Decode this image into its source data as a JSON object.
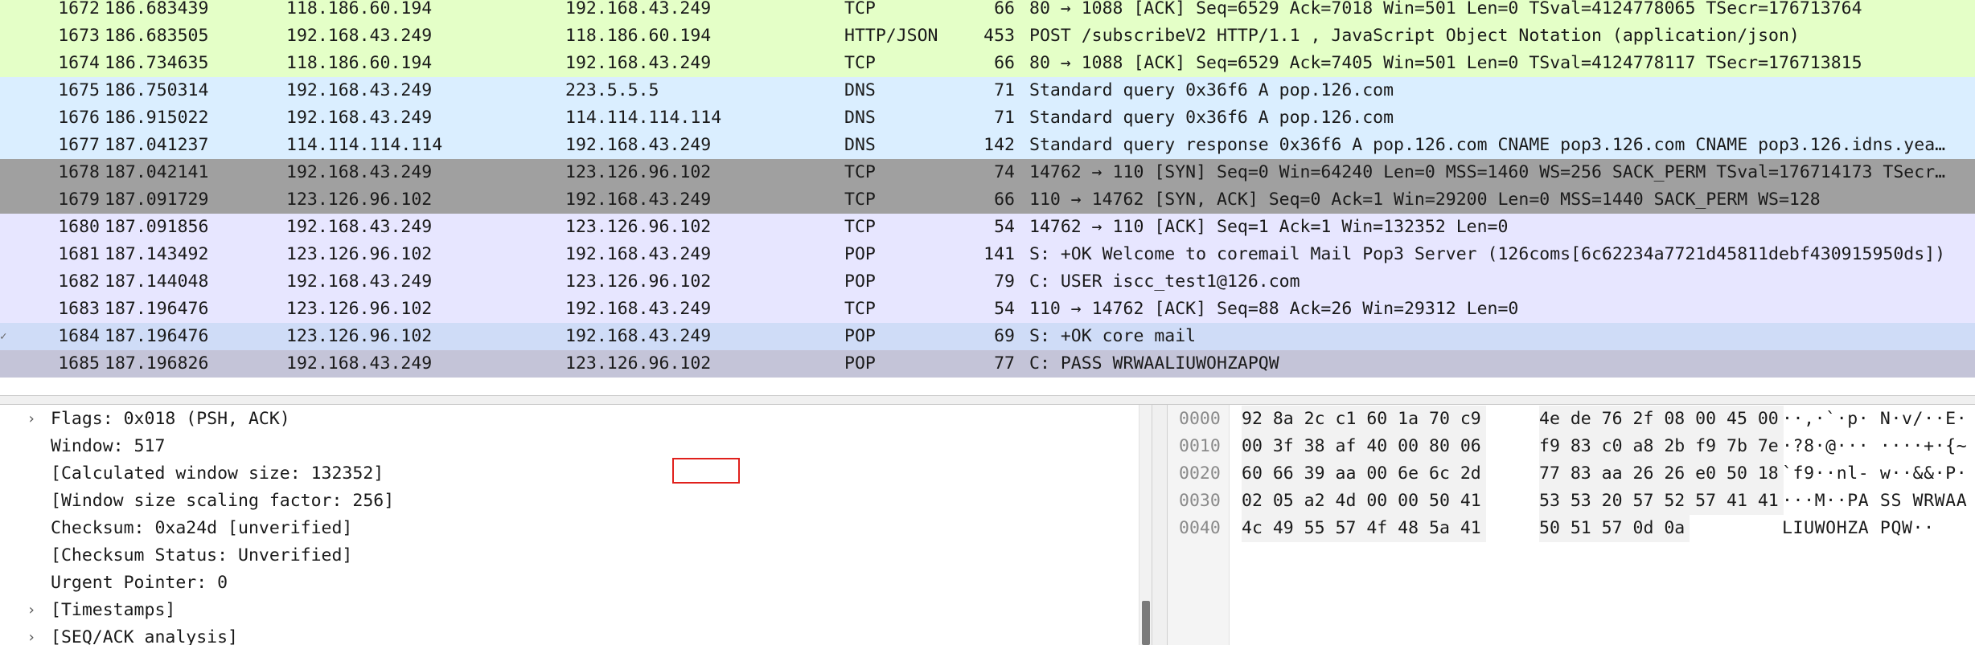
{
  "packets": [
    {
      "no": "1672",
      "time": "186.683439",
      "src": "118.186.60.194",
      "dst": "192.168.43.249",
      "proto": "TCP",
      "len": "66",
      "info": "80 → 1088 [ACK] Seq=6529 Ack=7018 Win=501 Len=0 TSval=4124778065 TSecr=176713764",
      "bg": "#e4ffc7"
    },
    {
      "no": "1673",
      "time": "186.683505",
      "src": "192.168.43.249",
      "dst": "118.186.60.194",
      "proto": "HTTP/JSON",
      "len": "453",
      "info": "POST /subscribeV2 HTTP/1.1 , JavaScript Object Notation (application/json)",
      "bg": "#e4ffc7"
    },
    {
      "no": "1674",
      "time": "186.734635",
      "src": "118.186.60.194",
      "dst": "192.168.43.249",
      "proto": "TCP",
      "len": "66",
      "info": "80 → 1088 [ACK] Seq=6529 Ack=7405 Win=501 Len=0 TSval=4124778117 TSecr=176713815",
      "bg": "#e4ffc7"
    },
    {
      "no": "1675",
      "time": "186.750314",
      "src": "192.168.43.249",
      "dst": "223.5.5.5",
      "proto": "DNS",
      "len": "71",
      "info": "Standard query 0x36f6 A pop.126.com",
      "bg": "#daeeff"
    },
    {
      "no": "1676",
      "time": "186.915022",
      "src": "192.168.43.249",
      "dst": "114.114.114.114",
      "proto": "DNS",
      "len": "71",
      "info": "Standard query 0x36f6 A pop.126.com",
      "bg": "#daeeff"
    },
    {
      "no": "1677",
      "time": "187.041237",
      "src": "114.114.114.114",
      "dst": "192.168.43.249",
      "proto": "DNS",
      "len": "142",
      "info": "Standard query response 0x36f6 A pop.126.com CNAME pop3.126.com CNAME pop3.126.idns.yea…",
      "bg": "#daeeff"
    },
    {
      "no": "1678",
      "time": "187.042141",
      "src": "192.168.43.249",
      "dst": "123.126.96.102",
      "proto": "TCP",
      "len": "74",
      "info": "14762 → 110 [SYN] Seq=0 Win=64240 Len=0 MSS=1460 WS=256 SACK_PERM TSval=176714173 TSecr…",
      "bg": "#a0a0a0"
    },
    {
      "no": "1679",
      "time": "187.091729",
      "src": "123.126.96.102",
      "dst": "192.168.43.249",
      "proto": "TCP",
      "len": "66",
      "info": "110 → 14762 [SYN, ACK] Seq=0 Ack=1 Win=29200 Len=0 MSS=1440 SACK_PERM WS=128",
      "bg": "#a0a0a0"
    },
    {
      "no": "1680",
      "time": "187.091856",
      "src": "192.168.43.249",
      "dst": "123.126.96.102",
      "proto": "TCP",
      "len": "54",
      "info": "14762 → 110 [ACK] Seq=1 Ack=1 Win=132352 Len=0",
      "bg": "#e7e6ff"
    },
    {
      "no": "1681",
      "time": "187.143492",
      "src": "123.126.96.102",
      "dst": "192.168.43.249",
      "proto": "POP",
      "len": "141",
      "info": "S: +OK Welcome to coremail Mail Pop3 Server (126coms[6c62234a7721d45811debf430915950ds])",
      "bg": "#e7e6ff"
    },
    {
      "no": "1682",
      "time": "187.144048",
      "src": "192.168.43.249",
      "dst": "123.126.96.102",
      "proto": "POP",
      "len": "79",
      "info": "C: USER iscc_test1@126.com",
      "bg": "#e7e6ff"
    },
    {
      "no": "1683",
      "time": "187.196476",
      "src": "123.126.96.102",
      "dst": "192.168.43.249",
      "proto": "TCP",
      "len": "54",
      "info": "110 → 14762 [ACK] Seq=88 Ack=26 Win=29312 Len=0",
      "bg": "#e7e6ff"
    },
    {
      "no": "1684",
      "time": "187.196476",
      "src": "123.126.96.102",
      "dst": "192.168.43.249",
      "proto": "POP",
      "len": "69",
      "info": "S: +OK core mail",
      "bg": "#cfdcf7",
      "mark": "✓"
    },
    {
      "no": "1685",
      "time": "187.196826",
      "src": "192.168.43.249",
      "dst": "123.126.96.102",
      "proto": "POP",
      "len": "77",
      "info": "C: PASS WRWAALIUWOHZAPQW",
      "bg": "#c4c4d8"
    }
  ],
  "details": [
    {
      "text": "Flags: 0x018 (PSH, ACK)",
      "expandable": true
    },
    {
      "text": "Window: 517",
      "expandable": false
    },
    {
      "text": "[Calculated window size: 132352]",
      "expandable": false
    },
    {
      "text": "[Window size scaling factor: 256]",
      "expandable": false
    },
    {
      "text": "Checksum: 0xa24d [unverified]",
      "expandable": false
    },
    {
      "text": "[Checksum Status: Unverified]",
      "expandable": false
    },
    {
      "text": "Urgent Pointer: 0",
      "expandable": false
    },
    {
      "text": "[Timestamps]",
      "expandable": true
    },
    {
      "text": "[SEQ/ACK analysis]",
      "expandable": true
    }
  ],
  "bytes": [
    {
      "offset": "0000",
      "hex1": "92 8a 2c c1 60 1a 70 c9",
      "hex2": "4e de 76 2f 08 00 45 00",
      "ascii": "··,·`·p· N·v/··E·"
    },
    {
      "offset": "0010",
      "hex1": "00 3f 38 af 40 00 80 06",
      "hex2": "f9 83 c0 a8 2b f9 7b 7e",
      "ascii": "·?8·@··· ····+·{~"
    },
    {
      "offset": "0020",
      "hex1": "60 66 39 aa 00 6e 6c 2d",
      "hex2": "77 83 aa 26 26 e0 50 18",
      "ascii": "`f9··nl- w··&&·P·"
    },
    {
      "offset": "0030",
      "hex1": "02 05 a2 4d 00 00 50 41",
      "hex2": "53 53 20 57 52 57 41 41",
      "ascii": "···M··PA SS WRWAA"
    },
    {
      "offset": "0040",
      "hex1": "4c 49 55 57 4f 48 5a 41",
      "hex2": "50 51 57 0d 0a",
      "ascii": "LIUWOHZA PQW··"
    }
  ],
  "icons": {
    "expand": "chevron-right-icon",
    "marker": "related-packet-icon"
  },
  "colors": {
    "highlight_box": "#e0201c"
  }
}
